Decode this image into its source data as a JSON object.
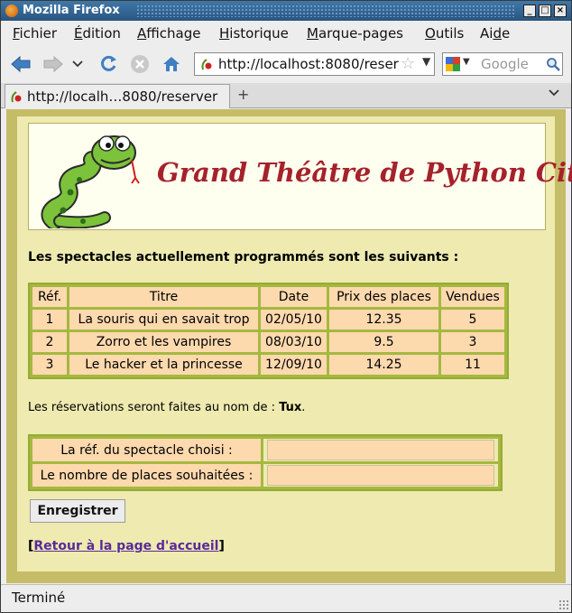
{
  "window": {
    "title": "Mozilla Firefox",
    "controls": {
      "minimize": "_",
      "maximize": "□",
      "close": "×"
    }
  },
  "menu": {
    "items": [
      {
        "pre": "",
        "ul": "F",
        "post": "ichier"
      },
      {
        "pre": "",
        "ul": "É",
        "post": "dition"
      },
      {
        "pre": "",
        "ul": "A",
        "post": "ffichage"
      },
      {
        "pre": "",
        "ul": "H",
        "post": "istorique"
      },
      {
        "pre": "",
        "ul": "M",
        "post": "arque-pages"
      },
      {
        "pre": "",
        "ul": "O",
        "post": "utils"
      },
      {
        "pre": "Ai",
        "ul": "d",
        "post": "e"
      }
    ]
  },
  "nav": {
    "url": "http://localhost:8080/reserver",
    "search_placeholder": "Google"
  },
  "tab": {
    "label": "http://localh…8080/reserver",
    "new_tab": "+",
    "list": "⌄"
  },
  "page": {
    "banner_title": "Grand Théâtre de Python City",
    "intro": "Les spectacles actuellement programmés sont les suivants :",
    "table": {
      "headers": [
        "Réf.",
        "Titre",
        "Date",
        "Prix des places",
        "Vendues"
      ],
      "rows": [
        [
          "1",
          "La souris qui en savait trop",
          "02/05/10",
          "12.35",
          "5"
        ],
        [
          "2",
          "Zorro et les vampires",
          "08/03/10",
          "9.5",
          "3"
        ],
        [
          "3",
          "Le hacker et la princesse",
          "12/09/10",
          "14.25",
          "11"
        ]
      ]
    },
    "reservation_prefix": "Les réservations seront faites au nom de : ",
    "reservation_name": "Tux",
    "reservation_suffix": ".",
    "form": {
      "ref_label": "La réf. du spectacle choisi :",
      "ref_value": "",
      "places_label": "Le nombre de places souhaitées :",
      "places_value": ""
    },
    "submit_label": "Enregistrer",
    "back_open": "[",
    "back_link": "Retour à la page d'accueil",
    "back_close": "]"
  },
  "status": {
    "text": "Terminé"
  }
}
